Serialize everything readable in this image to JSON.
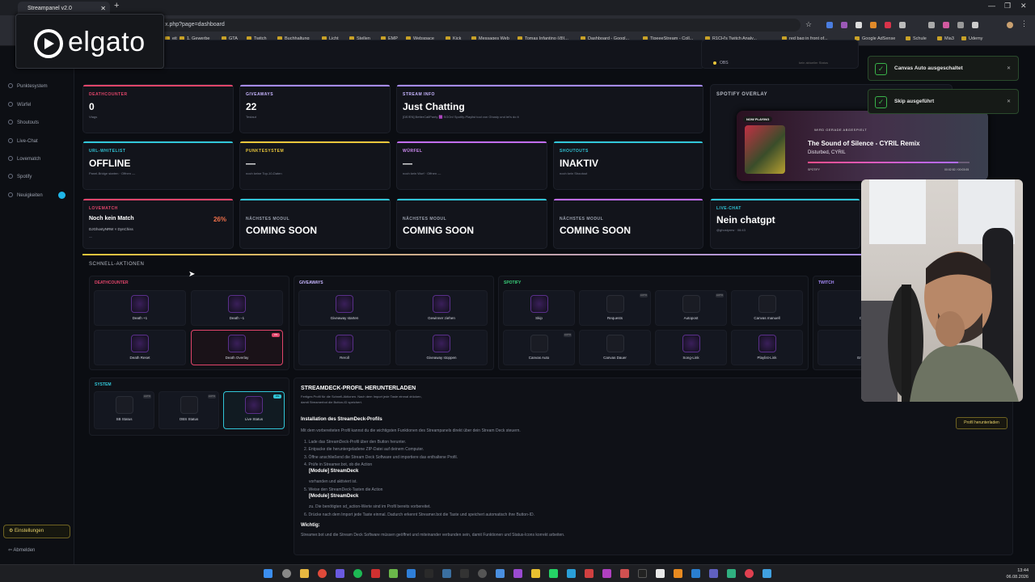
{
  "browser": {
    "tab_title": "Streampanel v2.0",
    "url": "x.php?page=dashboard",
    "bookmarks": [
      "eit",
      "1. Gewerbe",
      "GTA",
      "Twitch",
      "Buchhaltung",
      "Licht",
      "Stellen",
      "EMP",
      "Webspace",
      "Kick",
      "Messages Web",
      "Tomas Infantino (@I...",
      "Dashboard - Googl...",
      "TipeeeStream - Coll...",
      "R1CH's Twitch Analy...",
      "red bag in front of...",
      "Google AdSense",
      "Schule",
      "Mia3",
      "Udemy"
    ]
  },
  "elgato_overlay": {
    "brand": "elgato"
  },
  "sidebar": {
    "items": [
      "Punktesystem",
      "Würfel",
      "Shoutouts",
      "Live-Chat",
      "Lovematch",
      "Spotify",
      "Neuigkeiten"
    ],
    "settings": "Einstellungen",
    "logout": "Abmelden",
    "top_badge": "eit"
  },
  "status": {
    "obs_label": "OBS",
    "obs_sub": "kein aktueller Status"
  },
  "cards": {
    "deathcounter": {
      "title": "DEATHCOUNTER",
      "value": "0",
      "sub": "Vtags",
      "color": "#e0456a"
    },
    "giveaways": {
      "title": "GIVEAWAYS",
      "value": "22",
      "sub": "Testaut",
      "color": "#a78bfa"
    },
    "streaminfo": {
      "title": "STREAM INFO",
      "value": "Just Chatting",
      "sub": "[DE/EN] BetterCallPanty 🟪 SGOn! Spotify-Playlist tool von Ghosty und let's do it",
      "color": "#a78bfa"
    },
    "urlwhitelist": {
      "title": "URL-WHITELIST",
      "value": "OFFLINE",
      "sub": "Panel-Bridge starten · Offnen —",
      "color": "#31c6d8"
    },
    "punktesystem": {
      "title": "PUNKTESYSTEM",
      "value": "—",
      "sub": "noch keine Top-10-Daten",
      "color": "#e8c53a"
    },
    "wuerfel": {
      "title": "WÜRFEL",
      "value": "—",
      "sub": "noch kein Wurf · Offnen —",
      "color": "#c06cf0"
    },
    "shoutouts": {
      "title": "SHOUTOUTS",
      "value": "INAKTIV",
      "sub": "noch kein Shoutout",
      "color": "#31c6d8"
    },
    "lovematch": {
      "title": "LOVEMATCH",
      "value": "Noch kein Match",
      "percent": "26%",
      "sub": "DJGhostyNRW × DynChiss",
      "sub2": "—",
      "color": "#e0456a"
    },
    "next1": {
      "title": "NÄCHSTES MODUL",
      "value": "COMING SOON",
      "color": "#31c6d8"
    },
    "next2": {
      "title": "NÄCHSTES MODUL",
      "value": "COMING SOON",
      "color": "#31c6d8"
    },
    "next3": {
      "title": "NÄCHSTES MODUL",
      "value": "COMING SOON",
      "color": "#c06cf0"
    },
    "livechat": {
      "title": "LIVE-CHAT",
      "value": "Nein chatgpt",
      "sub": "@ghostynrw · 06:43",
      "color": "#31c6d8"
    }
  },
  "spotify": {
    "title": "SPOTIFY OVERLAY",
    "now_playing": "NOW PLAYING",
    "header": "WIRD GERADE ABGESPIELT",
    "song": "The Sound of Silence - CYRIL Remix",
    "artist": "Disturbed, CYRIL",
    "brand": "SPOTIFY",
    "time": "00:02:52 / 00:03:05",
    "progress": 0.93
  },
  "toasts": [
    "Canvas Auto ausgeschaltet",
    "Skip ausgeführt"
  ],
  "quick_actions": {
    "title": "SCHNELL-AKTIONEN",
    "deathcounter": {
      "label": "DEATHCOUNTER",
      "buttons": [
        "Death +1",
        "Death −1",
        "Death Reset",
        "Death Overlay"
      ]
    },
    "giveaways": {
      "label": "GIVEAWAYS",
      "buttons": [
        "Giveaway starten",
        "Gewinner ziehen",
        "Reroll",
        "Giveaway stoppen"
      ]
    },
    "spotify": {
      "label": "SPOTIFY",
      "buttons": [
        "Skip",
        "Requests",
        "Autopost",
        "Canvas manuell",
        "Canvas Auto",
        "Canvas Dauer",
        "Song-Link",
        "Playlist-Link"
      ]
    },
    "twitch": {
      "label": "TWITCH",
      "buttons": [
        "Cl",
        "Em"
      ]
    },
    "system": {
      "label": "SYSTEM",
      "buttons": [
        "SB Status",
        "OBS Status",
        "Live Status"
      ]
    },
    "tags": {
      "auto": "AUTO",
      "on": "ON"
    }
  },
  "streamdeck": {
    "title": "STREAMDECK-PROFIL HERUNTERLADEN",
    "desc1": "Fertiges Profil für die Schnell-Aktionen. Nach dem Import jede Taste einmal drücken,",
    "desc2": "damit Streamerbot die Button-ID speichert.",
    "download": "Profil herunterladen",
    "install_title": "Installation des StreamDeck-Profils",
    "install_intro": "Mit dem vorbereiteten Profil kannst du die wichtigsten Funktionen des Streampanels direkt über dein Stream Deck steuern.",
    "steps": [
      "1. Lade das StreamDeck-Profil über den Button herunter.",
      "2. Entpacke die heruntergeladene ZIP-Datei auf deinem Computer.",
      "3. Öffne anschließend die Stream Deck Software und importiere das enthaltene Profil.",
      "4. Prüfe in Streamer.bot, ob die Action"
    ],
    "module1": "[Module] StreamDeck",
    "step4b": "vorhanden und aktiviert ist.",
    "step5": "5. Weise den StreamDeck-Tasten die Action",
    "module2": "[Module] StreamDeck",
    "step5b": "zu. Die benötigten sd_action-Werte sind im Profil bereits vorbereitet.",
    "step6": "6. Drücke nach dem Import jede Taste einmal. Dadurch erkennt Streamer.bot die Taste und speichert automatisch ihre Button-ID.",
    "important_title": "Wichtig:",
    "important": "Streamer.bot und die Stream Deck Software müssen geöffnet und miteinander verbunden sein, damit Funktionen und Status-Icons korrekt arbeiten."
  },
  "taskbar": {
    "time": "13:44",
    "date": "06.08.2026"
  }
}
